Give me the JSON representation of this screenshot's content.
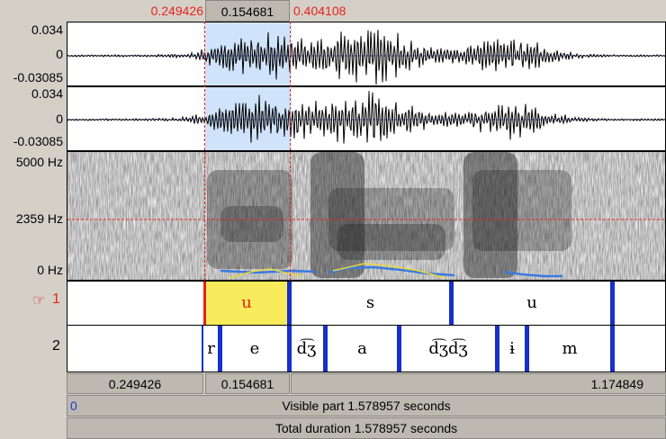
{
  "selection": {
    "start": "0.249426",
    "duration": "0.154681",
    "end": "0.404108"
  },
  "waveforms": [
    {
      "max": "0.034",
      "zero": "0",
      "min": "-0.03085"
    },
    {
      "max": "0.034",
      "zero": "0",
      "min": "-0.03085"
    }
  ],
  "spectrogram": {
    "top": "5000 Hz",
    "cursor": "2359 Hz",
    "bottom": "0 Hz"
  },
  "tiers": [
    {
      "number": "1",
      "pointer_icon": "☞",
      "labels": [
        "u",
        "s",
        "u"
      ]
    },
    {
      "number": "2",
      "labels": [
        "r",
        "e",
        "d͡ʒ",
        "a",
        "d͡ʒd͡ʒ",
        "ɨ",
        "m"
      ]
    }
  ],
  "bottom_bar": {
    "left_time": "0.249426",
    "selection_duration": "0.154681",
    "right_time": "1.174849",
    "visible_start": "0",
    "visible_label": "Visible part 1.578957 seconds",
    "total_label": "Total duration 1.578957 seconds"
  },
  "colors": {
    "selection": "#cfe3fb",
    "interval_highlight": "#f8ec5c",
    "cursor": "#e8221c",
    "boundary": "#1730c8"
  }
}
